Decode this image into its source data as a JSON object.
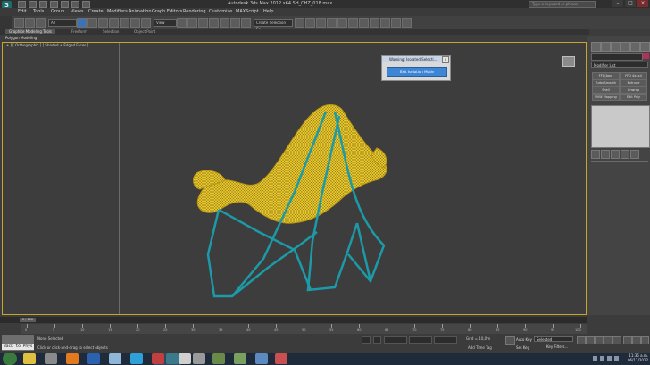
{
  "window": {
    "title": "Autodesk 3ds Max 2012 x64     SH_CHZ_018.max",
    "search_placeholder": "Type a keyword or phrase",
    "logo_text": "3"
  },
  "menu": [
    "Edit",
    "Tools",
    "Group",
    "Views",
    "Create",
    "Modifiers",
    "Animation",
    "Graph Editors",
    "Rendering",
    "Customize",
    "MAXScript",
    "Help"
  ],
  "toolbar": {
    "selection_filter": "All",
    "reference_coord": "View",
    "named_selection": "Create Selection Se..."
  },
  "ribbon": {
    "tabs": [
      "Graphite Modeling Tools",
      "Freeform",
      "Selection",
      "Object Paint"
    ],
    "sub_tab": "Polygon Modeling"
  },
  "viewport": {
    "label": "[ + ] [ Orthographic ] [ Shaded + Edged Faces ]"
  },
  "isolate_dialog": {
    "title": "Warning: Isolated Selecti...",
    "button": "Exit Isolation Mode",
    "close": "x"
  },
  "command_panel": {
    "modifier_list": "Modifier List",
    "modifiers": [
      "FFD(box)",
      "FFD 4x4x4",
      "TurboSmooth",
      "Extrude",
      "Shell",
      "Unwrap",
      "UVW Mapping",
      "Edit Poly"
    ]
  },
  "timeline": {
    "position": "0 / 100",
    "ticks": [
      "0",
      "5",
      "10",
      "15",
      "20",
      "25",
      "30",
      "35",
      "40",
      "45",
      "50",
      "55",
      "60",
      "65",
      "70",
      "75",
      "80",
      "85",
      "90",
      "95",
      "100"
    ]
  },
  "status": {
    "selection": "None Selected",
    "prompt": "Click or click-and-drag to select objects",
    "grid": "Grid = 10,0m",
    "add_time_tag": "Add Time Tag",
    "auto_key": "Auto Key",
    "auto_key_mode": "Selected",
    "set_key": "Set Key",
    "key_filters": "Key Filters...",
    "listener": "Back to Phys"
  },
  "taskbar": {
    "time": "11:36 a.m.",
    "date": "06/11/2012"
  },
  "colors": {
    "chair_fabric": "#e6c82e",
    "chair_frame": "#1c9aa8",
    "viewport_border": "#c8a728",
    "dialog_button": "#3d86d6",
    "object_color": "#b3305c"
  }
}
